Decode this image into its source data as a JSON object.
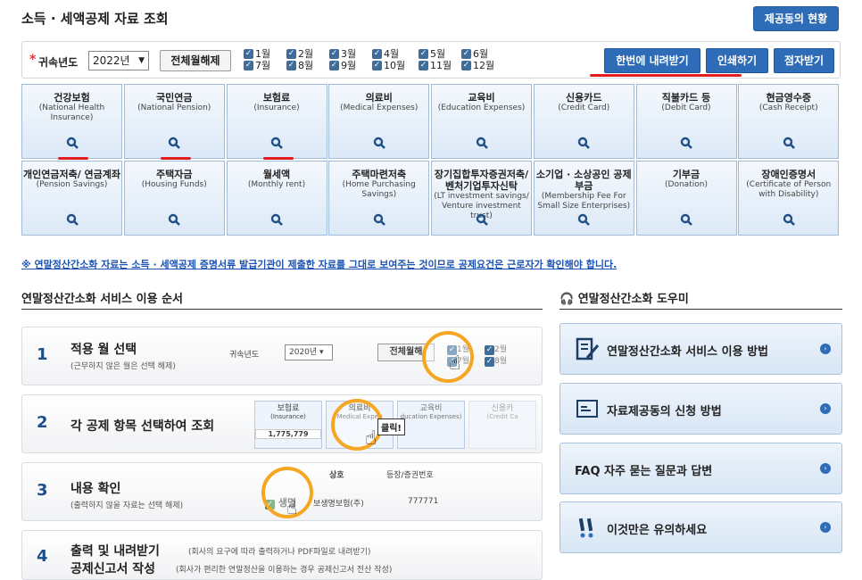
{
  "page_title": "소득 · 세액공제 자료 조회",
  "status_button": "제공동의 현황",
  "filter": {
    "required_mark": "*",
    "year_label": "귀속년도",
    "year_value": "2022년",
    "clear_all": "전체월해제",
    "months": [
      "1월",
      "2월",
      "3월",
      "4월",
      "5월",
      "6월",
      "7월",
      "8월",
      "9월",
      "10월",
      "11월",
      "12월"
    ],
    "download_all": "한번에 내려받기",
    "print": "인쇄하기",
    "e_receive": "점자받기"
  },
  "categories": [
    {
      "ko": "건강보험",
      "en": "(National Health Insurance)"
    },
    {
      "ko": "국민연금",
      "en": "(National Pension)"
    },
    {
      "ko": "보험료",
      "en": "(Insurance)"
    },
    {
      "ko": "의료비",
      "en": "(Medical Expenses)"
    },
    {
      "ko": "교육비",
      "en": "(Education Expenses)"
    },
    {
      "ko": "신용카드",
      "en": "(Credit Card)"
    },
    {
      "ko": "직불카드 등",
      "en": "(Debit Card)"
    },
    {
      "ko": "현금영수증",
      "en": "(Cash Receipt)"
    },
    {
      "ko": "개인연금저축/ 연금계좌",
      "en": "(Pension Savings)"
    },
    {
      "ko": "주택자금",
      "en": "(Housing Funds)"
    },
    {
      "ko": "월세액",
      "en": "(Monthly rent)"
    },
    {
      "ko": "주택마련저축",
      "en": "(Home Purchasing Savings)"
    },
    {
      "ko": "장기집합투자증권저축/ 벤처기업투자신탁",
      "en": "(LT investment savings/ Venture investment trust)"
    },
    {
      "ko": "소기업 · 소상공인 공제부금",
      "en": "(Membership Fee For Small Size Enterprises)"
    },
    {
      "ko": "기부금",
      "en": "(Donation)"
    },
    {
      "ko": "장애인증명서",
      "en": "(Certificate of Person with Disability)"
    }
  ],
  "notice": "※ 연말정산간소화 자료는 소득 · 세액공제 증명서류 발급기관이 제출한 자료를 그대로 보여주는 것이므로 공제요건은 근로자가 확인해야 합니다.",
  "steps_title": "연말정산간소화 서비스 이용 순서",
  "steps": [
    {
      "num": "1",
      "title": "적용 월 선택",
      "sub": "(근무하지 않은 월은 선택 해제)",
      "demo": {
        "year_label": "귀속년도",
        "year_value": "2020년",
        "clear": "전체월해",
        "months": [
          "1월",
          "2월",
          "7월",
          "8월"
        ]
      }
    },
    {
      "num": "2",
      "title": "각 공제 항목 선택하여 조회",
      "sub": "",
      "demo": {
        "c1": "보험료",
        "c1en": "(Insurance)",
        "value": "1,775,779",
        "c2": "의료비",
        "c2en": "Medical Expen",
        "click": "클릭!",
        "c3": "교육비",
        "c3en": "ducation Expenses)",
        "c4": "신용카",
        "c4en": "(Credit Ca"
      }
    },
    {
      "num": "3",
      "title": "내용 확인",
      "sub": "(출력하지 않을 자료는 선택 해제)",
      "demo": {
        "h1": "상호",
        "h2": "등장/증권번호",
        "row1": "생명",
        "row1b": "보생명보험(주)",
        "row1c": "777771"
      }
    },
    {
      "num": "4",
      "title": "출력 및 내려받기",
      "sub": "(회사의 요구에 따라 출력하거나 PDF파일로 내려받기)",
      "title2": "공제신고서 작성",
      "sub2": "(회사가 편리한 연말정산을 이용하는 경우 공제신고서 전산 작성)"
    }
  ],
  "help_title": "연말정산간소화 도우미",
  "help_items": [
    {
      "label": "연말정산간소화 서비스 이용 방법",
      "icon": "document-pen-icon"
    },
    {
      "label": "자료제공동의 신청 방법",
      "icon": "document-icon"
    },
    {
      "label": "FAQ 자주 묻는 질문과 답변",
      "icon": "faq-icon"
    },
    {
      "label": "이것만은 유의하세요",
      "icon": "exclamation-icon"
    }
  ],
  "colors": {
    "accent": "#2e6cb8",
    "highlight": "#e31d1d",
    "callout": "#f5a623"
  }
}
